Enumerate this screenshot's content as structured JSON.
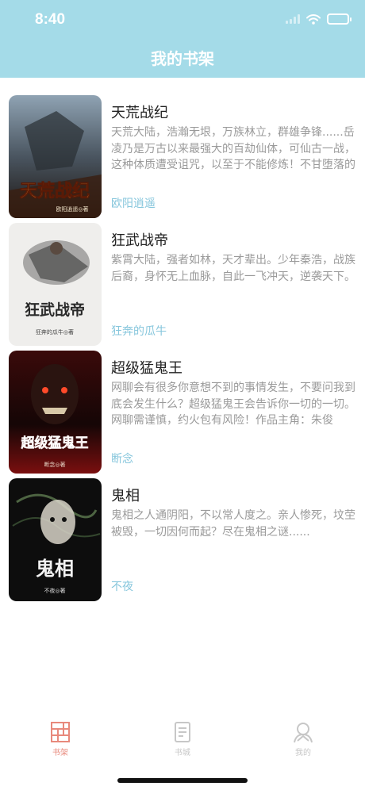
{
  "status_bar": {
    "time": "8:40"
  },
  "header": {
    "title": "我的书架"
  },
  "books": [
    {
      "title": "天荒战纪",
      "description": "天荒大陆，浩瀚无垠，万族林立，群雄争锋......岳凌乃是万古以来最强大的百劫仙体，可仙古一战，这种体质遭受诅咒，以至于不能修炼！不甘堕落的他，偶得一缕龙魂，踏上强者之路。历…",
      "author": "欧阳逍遥",
      "cover_title": "天荒战纪",
      "cover_author": "欧阳逍遥◎著"
    },
    {
      "title": "狂武战帝",
      "description": "紫霄大陆，强者如林，天才辈出。少年秦浩，战族后裔，身怀无上血脉，自此一飞冲天，逆袭天下。",
      "author": "狂奔的瓜牛",
      "cover_title": "狂武战帝",
      "cover_author": "狂奔的瓜牛◎著"
    },
    {
      "title": "超级猛鬼王",
      "description": "网聊会有很多你意想不到的事情发生，不要问我到底会发生什么？超级猛鬼王会告诉你一切的一切。网聊需谨慎，约火包有风险！作品主角：朱俊",
      "author": "断念",
      "cover_title": "超级猛鬼王",
      "cover_author": "断念◎著"
    },
    {
      "title": "鬼相",
      "description": "鬼相之人通阴阳，不以常人度之。亲人惨死，坟茔被毁，一切因何而起？尽在鬼相之谜......",
      "author": "不夜",
      "cover_title": "鬼相",
      "cover_author": "不夜◎著"
    }
  ],
  "tabbar": {
    "items": [
      {
        "label": "书架",
        "icon": "bookshelf-icon",
        "active": true
      },
      {
        "label": "书城",
        "icon": "book-store-icon",
        "active": false
      },
      {
        "label": "我的",
        "icon": "profile-icon",
        "active": false
      }
    ]
  },
  "colors": {
    "header": "#a4dbe8",
    "author_link": "#86c6dc",
    "tab_active": "#e8897c",
    "tab_inactive": "#c7c7c7"
  }
}
